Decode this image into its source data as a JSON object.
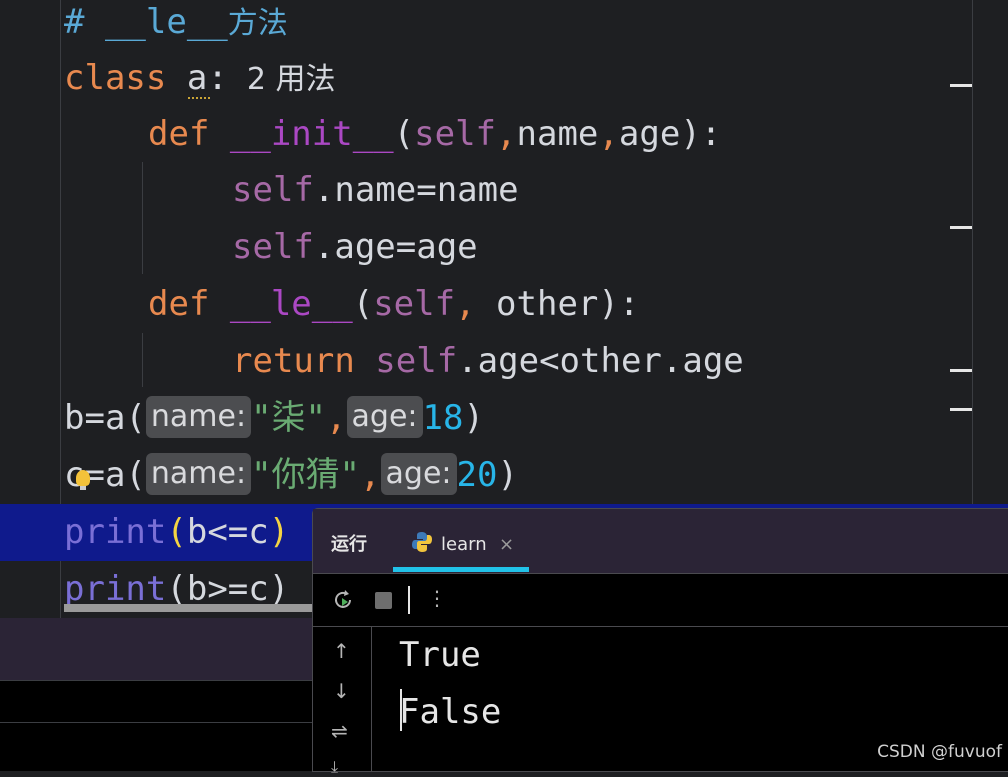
{
  "code": {
    "line1": {
      "comment": "# __le__",
      "comment_cn": "方法"
    },
    "line2": {
      "kw": "class ",
      "name": "a",
      "colon": ":",
      "inlay": "  2 用法"
    },
    "line3": {
      "kw": "def ",
      "fn": "__init__",
      "open": "(",
      "self": "self",
      "comma1": ",",
      "p1": "name",
      "comma2": ",",
      "p2": "age",
      "close": "):"
    },
    "line4": {
      "self": "self",
      "rest": ".name=name"
    },
    "line5": {
      "self": "self",
      "rest": ".age=age"
    },
    "line6": {
      "kw": "def ",
      "fn": "__le__",
      "open": "(",
      "self": "self",
      "comma": ",",
      "p": " other",
      "close": "):"
    },
    "line7": {
      "kw": "return ",
      "self": "self",
      "rest": ".age<other.age"
    },
    "line8": {
      "pre": "b=a(",
      "hint1": "name:",
      "str": "\"柒\"",
      "comma": ",",
      "hint2": "age:",
      "num": "18",
      "close": ")"
    },
    "line9": {
      "pre": "c=a(",
      "hint1": "name:",
      "str": "\"你猜\"",
      "comma": ",",
      "hint2": "age:",
      "num": "20",
      "close": ")"
    },
    "line10": {
      "fn": "print",
      "open": "(",
      "arg": "b<=c",
      "close": ")"
    },
    "line11": {
      "fn": "print",
      "open": "(",
      "arg": "b>=c",
      "close": ")"
    }
  },
  "run_panel": {
    "title": "运行",
    "tab_label": "learn",
    "tab_close": "×",
    "icons": {
      "rerun": "rerun-icon",
      "stop": "stop-icon",
      "more": "more-icon",
      "up": "arrow-up-icon",
      "down": "arrow-down-icon",
      "wrap": "soft-wrap-icon",
      "scroll": "scroll-end-icon"
    },
    "output": [
      "True",
      "False"
    ]
  },
  "watermark": "CSDN @fuvuof",
  "colors": {
    "keyword": "#e8894f",
    "function": "#ab48c4",
    "string": "#6aab73",
    "number": "#28b5e8",
    "highlight": "#0f1a8c",
    "tab_underline": "#21c2e8"
  }
}
